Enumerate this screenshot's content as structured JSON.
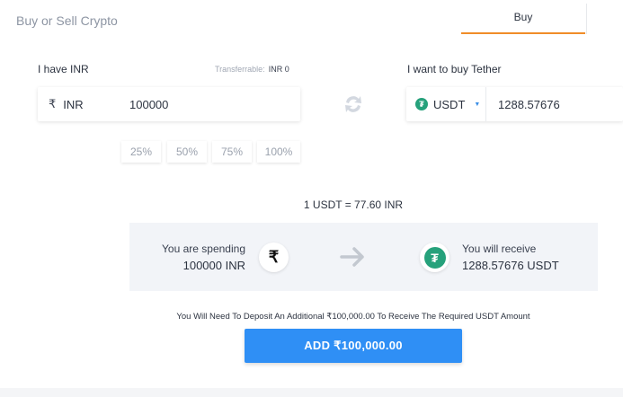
{
  "header": {
    "title": "Buy or Sell Crypto",
    "tab_buy": "Buy"
  },
  "left": {
    "label": "I have INR",
    "transfer_label": "Transferrable:",
    "transfer_value": "INR 0",
    "currency_symbol": "₹",
    "currency": "INR",
    "amount": "100000"
  },
  "right": {
    "label": "I want to buy Tether",
    "currency": "USDT",
    "amount": "1288.57676"
  },
  "percent_buttons": [
    "25%",
    "50%",
    "75%",
    "100%"
  ],
  "rate": "1 USDT = 77.60 INR",
  "summary": {
    "spend_label": "You are spending",
    "spend_value": "100000 INR",
    "spend_icon": "₹",
    "receive_label": "You will receive",
    "receive_value": "1288.57676 USDT",
    "receive_icon": "₮"
  },
  "notice": "You Will Need To Deposit An Additional ₹100,000.00 To Receive The Required USDT Amount",
  "cta_label": "ADD ₹100,000.00",
  "colors": {
    "accent": "#2f8ff5",
    "tab_underline": "#f08c28",
    "tether": "#26a17b"
  }
}
